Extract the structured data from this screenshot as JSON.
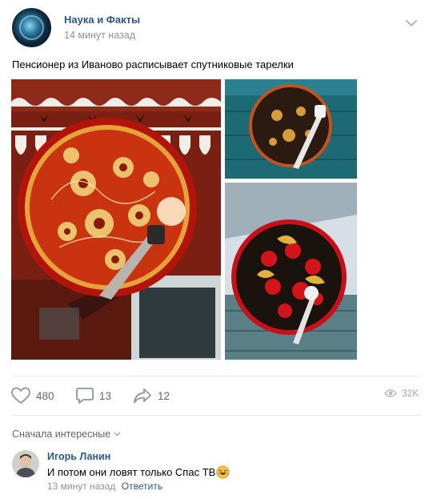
{
  "post": {
    "author": "Наука и Факты",
    "time": "14 минут назад",
    "text": "Пенсионер из Иваново расписывает спутниковые тарелки",
    "photos": [
      "photo-large-red-dish",
      "photo-dark-dish-on-wall",
      "photo-strawberry-dish"
    ]
  },
  "actions": {
    "likes": "480",
    "comments": "13",
    "shares": "12",
    "views": "32K"
  },
  "icons": {
    "menu": "chevron-down-icon",
    "like": "heart-icon",
    "comment": "comment-icon",
    "share": "share-arrow-icon",
    "views": "eye-icon",
    "emoji": "laughing-emoji-icon"
  },
  "comments_section": {
    "sort_label": "Сначала интересные",
    "comment": {
      "author": "Игорь Ланин",
      "text": "И потом они ловят только Спас ТВ",
      "time": "13 минут назад",
      "reply_label": "Ответить"
    }
  },
  "colors": {
    "link": "#2a5885",
    "meta": "#939393",
    "action": "#5f6a75",
    "divider": "#e7e8ec"
  }
}
